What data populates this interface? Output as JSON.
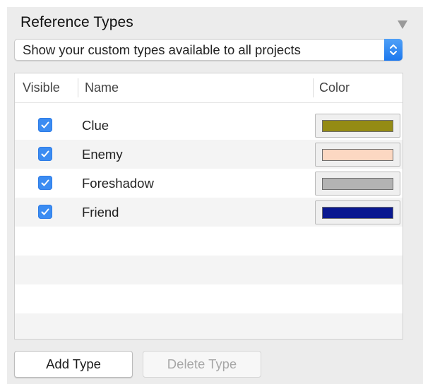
{
  "panel": {
    "title": "Reference Types"
  },
  "scope_popup": {
    "selected": "Show your custom types available to all projects"
  },
  "table": {
    "columns": [
      "Visible",
      "Name",
      "Color"
    ],
    "rows": [
      {
        "visible": true,
        "name": "Clue",
        "color": "#948b14"
      },
      {
        "visible": true,
        "name": "Enemy",
        "color": "#fcd8c2"
      },
      {
        "visible": true,
        "name": "Foreshadow",
        "color": "#b3b3b3"
      },
      {
        "visible": true,
        "name": "Friend",
        "color": "#0a1890"
      }
    ]
  },
  "buttons": {
    "add": "Add Type",
    "delete": "Delete Type"
  },
  "colors": {
    "accent": "#3b8cf2",
    "panel_bg": "#ececec"
  }
}
